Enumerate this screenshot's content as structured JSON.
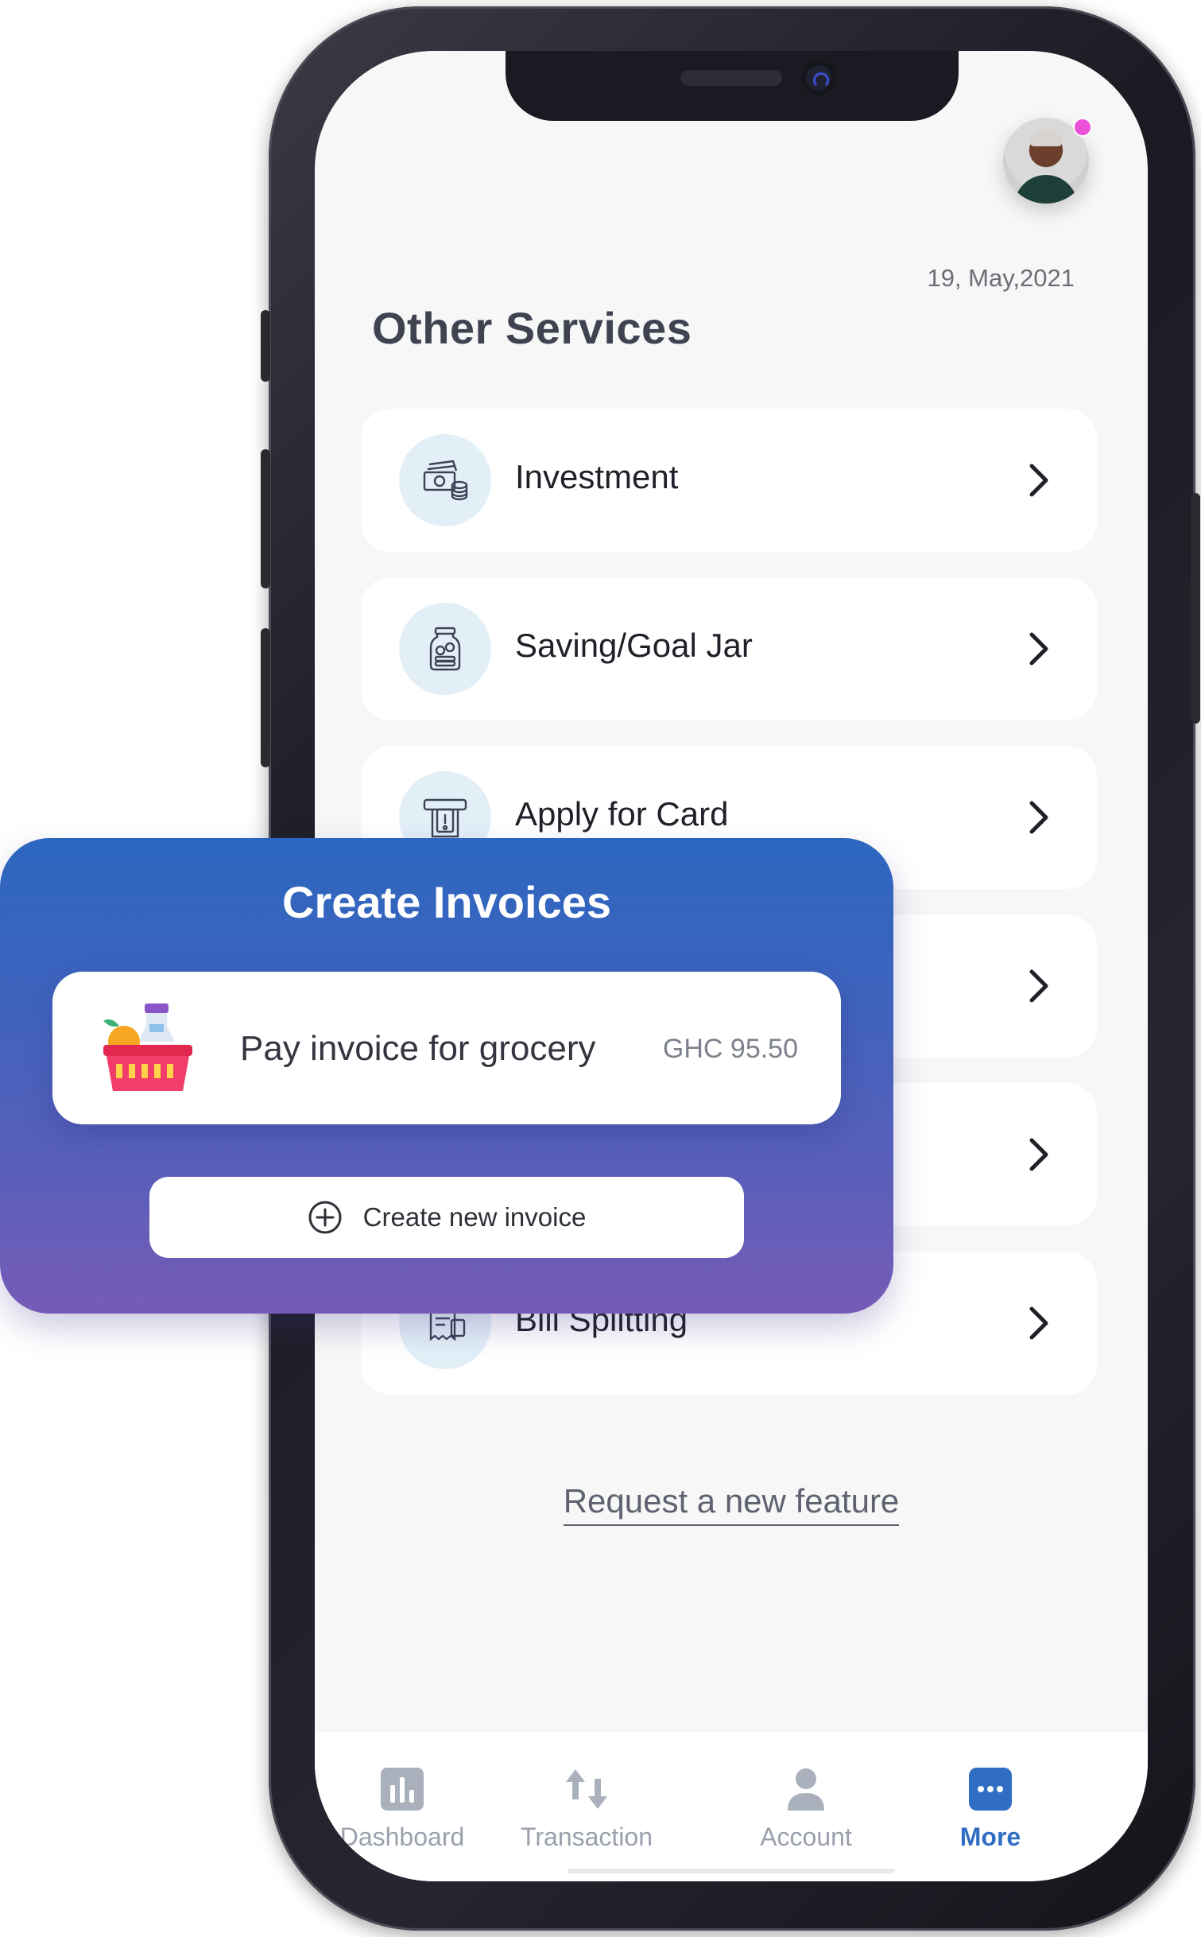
{
  "header": {
    "date": "19, May,2021",
    "title": "Other Services"
  },
  "services": [
    {
      "label": "Investment",
      "icon": "money-stack-icon"
    },
    {
      "label": "Saving/Goal Jar",
      "icon": "jar-icon"
    },
    {
      "label": "Apply for Card",
      "icon": "atm-card-icon"
    },
    {
      "label": "",
      "icon": ""
    },
    {
      "label": "",
      "icon": ""
    },
    {
      "label": "Bill Splitting",
      "icon": "bill-icon"
    }
  ],
  "request_link": "Request a new feature",
  "tabs": [
    {
      "label": "Dashboard",
      "icon": "bar-chart-icon",
      "active": false
    },
    {
      "label": "Transaction",
      "icon": "arrows-up-down-icon",
      "active": false
    },
    {
      "label": "Account",
      "icon": "person-icon",
      "active": false
    },
    {
      "label": "More",
      "icon": "more-dots-icon",
      "active": true
    }
  ],
  "invoice_panel": {
    "title": "Create Invoices",
    "item_label": "Pay invoice for grocery",
    "item_amount": "GHC 95.50",
    "create_button": "Create new invoice"
  },
  "colors": {
    "accent": "#2f6ec2",
    "panel_top": "#2c67bf",
    "panel_bottom": "#765bb7",
    "notification_dot": "#ec4fd8"
  }
}
